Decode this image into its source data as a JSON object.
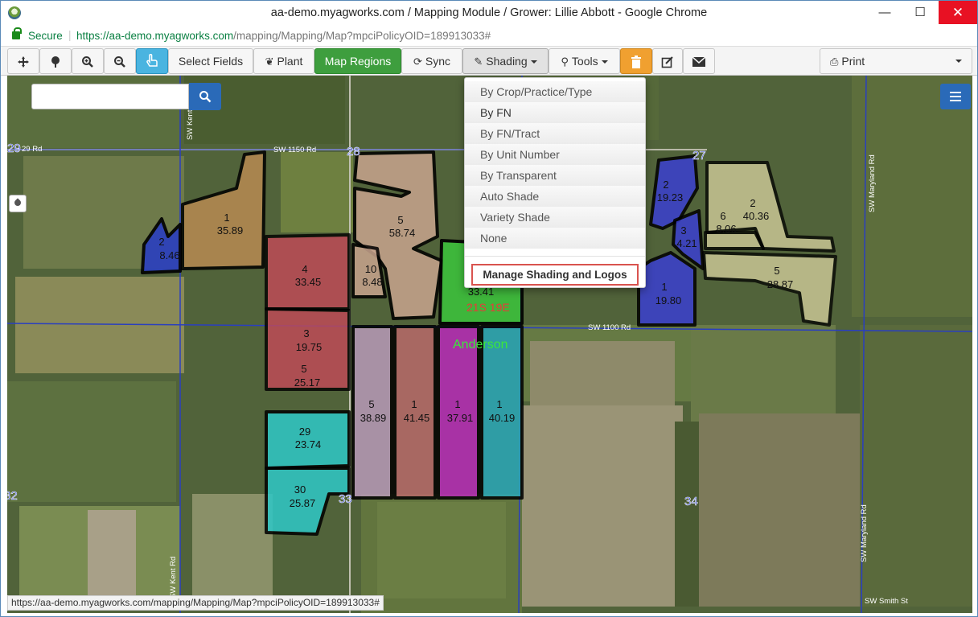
{
  "window": {
    "title": "aa-demo.myagworks.com / Mapping Module / Grower: Lillie Abbott - Google Chrome",
    "minimize": "—",
    "maximize": "☐",
    "close": "✕"
  },
  "address": {
    "secure_label": "Secure",
    "url_host": "https://aa-demo.myagworks.com",
    "url_path": "/mapping/Mapping/Map?mpciPolicyOID=189913033#"
  },
  "toolbar": {
    "select_fields": "Select Fields",
    "plant": "Plant",
    "map_regions": "Map Regions",
    "sync": "Sync",
    "shading": "Shading",
    "tools": "Tools",
    "print": "Print"
  },
  "search": {
    "placeholder": ""
  },
  "shading_menu": {
    "items": [
      "By Crop/Practice/Type",
      "By FN",
      "By FN/Tract",
      "By Unit Number",
      "By Transparent",
      "Auto Shade",
      "Variety Shade",
      "None"
    ],
    "selected_index": 1,
    "manage": "Manage Shading and Logos"
  },
  "map": {
    "roads": [
      "SW 1150 Rd",
      "SW 1100 Rd",
      "SW Maryland Rd",
      "SW Maryland Rd",
      "SW Smith St",
      "SW Kent Rd",
      "SW Kent Rd",
      "29 Rd"
    ],
    "section_numbers": [
      "28",
      "27",
      "29",
      "33",
      "34",
      "32"
    ],
    "township": "21S 19E",
    "farm_name": "Anderson",
    "fields": [
      {
        "fn": "2",
        "acres": "8.46",
        "color": "#2a3fc0"
      },
      {
        "fn": "1",
        "acres": "35.89",
        "color": "#b88a52"
      },
      {
        "fn": "5",
        "acres": "58.74",
        "color": "#c8a48e"
      },
      {
        "fn": "10",
        "acres": "8.48",
        "color": "#c8a48e"
      },
      {
        "fn": "4",
        "acres": "33.45",
        "color": "#c44a58"
      },
      {
        "fn": "3",
        "acres": "19.75",
        "color": "#c44a58"
      },
      {
        "fn": "5",
        "acres": "25.17",
        "color": "#c44a58"
      },
      {
        "fn": "29",
        "acres": "23.74",
        "color": "#2ec8c8"
      },
      {
        "fn": "30",
        "acres": "25.87",
        "color": "#2ec8c8"
      },
      {
        "fn": "5",
        "acres": "38.89",
        "color": "#b89ab8"
      },
      {
        "fn": "1",
        "acres": "41.45",
        "color": "#b86a6a"
      },
      {
        "fn": "1",
        "acres": "37.91",
        "color": "#b82ab8"
      },
      {
        "fn": "1",
        "acres": "40.19",
        "color": "#2aa8b8"
      },
      {
        "fn": "",
        "acres": "33.41",
        "color": "#3cc03c"
      },
      {
        "fn": "2",
        "acres": "19.23",
        "color": "#3a3fd0"
      },
      {
        "fn": "3",
        "acres": "4.21",
        "color": "#3a3fd0"
      },
      {
        "fn": "1",
        "acres": "19.80",
        "color": "#3a3fd0"
      },
      {
        "fn": "2",
        "acres": "40.36",
        "color": "#d8d2a0"
      },
      {
        "fn": "6",
        "acres": "8.06",
        "color": "#d8d2a0"
      },
      {
        "fn": "5",
        "acres": "28.87",
        "color": "#d8d2a0"
      }
    ]
  },
  "statusbar": {
    "url": "https://aa-demo.myagworks.com/mapping/Mapping/Map?mpciPolicyOID=189913033#"
  }
}
